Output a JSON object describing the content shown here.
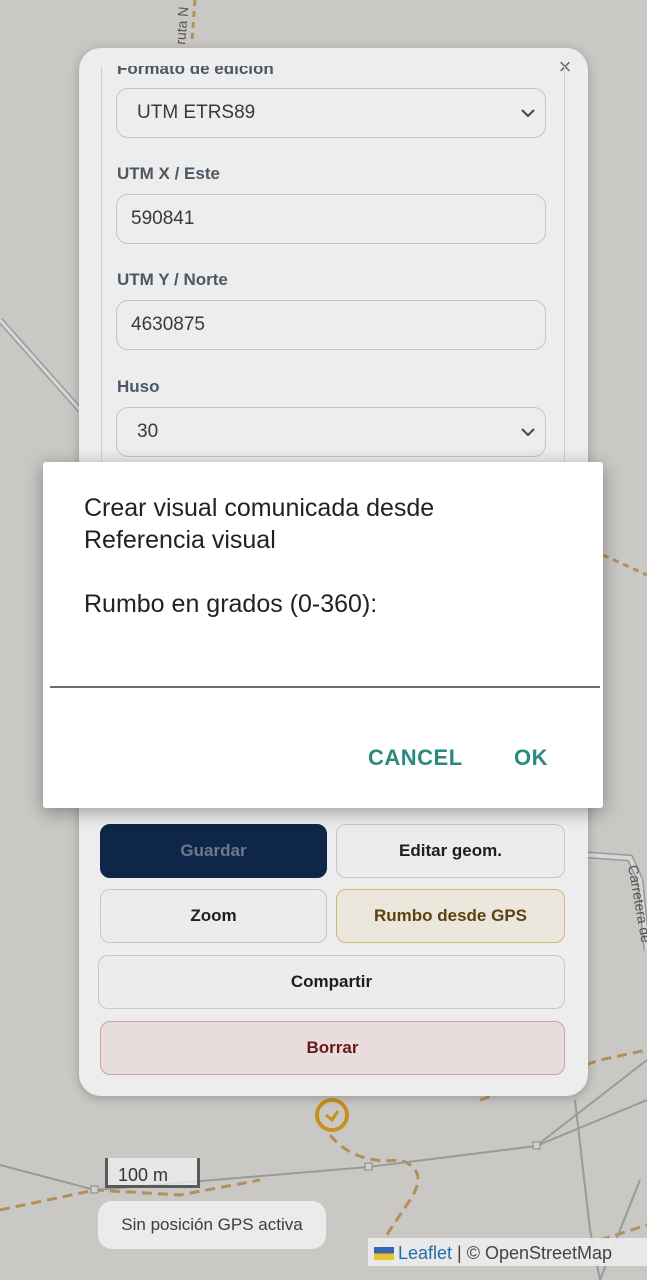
{
  "panel": {
    "close_glyph": "×",
    "labels": {
      "format": "Formato de edición",
      "utm_x": "UTM X / Este",
      "utm_y": "UTM Y / Norte",
      "huso": "Huso"
    },
    "values": {
      "format": "UTM ETRS89",
      "utm_x": "590841",
      "utm_y": "4630875",
      "huso": "30"
    },
    "buttons": {
      "guardar": "Guardar",
      "editar_geom": "Editar geom.",
      "zoom": "Zoom",
      "rumbo_gps": "Rumbo desde GPS",
      "compartir": "Compartir",
      "borrar": "Borrar"
    }
  },
  "dialog": {
    "title": "Crear visual comunicada desde Referencia visual",
    "message": "Rumbo en grados (0-360):",
    "input_value": "",
    "cancel": "CANCEL",
    "ok": "OK"
  },
  "map": {
    "scale_label": "100 m",
    "gps_status": "Sin posición GPS activa",
    "attribution_leaflet": "Leaflet",
    "attribution_sep": " | © ",
    "attribution_osm": "OpenStreetMap",
    "road_label_top": "ruta N",
    "road_label_right": "Carretera de",
    "colors": {
      "primary_button": "#0e264a",
      "dialog_button": "#2b8a80",
      "track": "#c89a3a"
    }
  }
}
